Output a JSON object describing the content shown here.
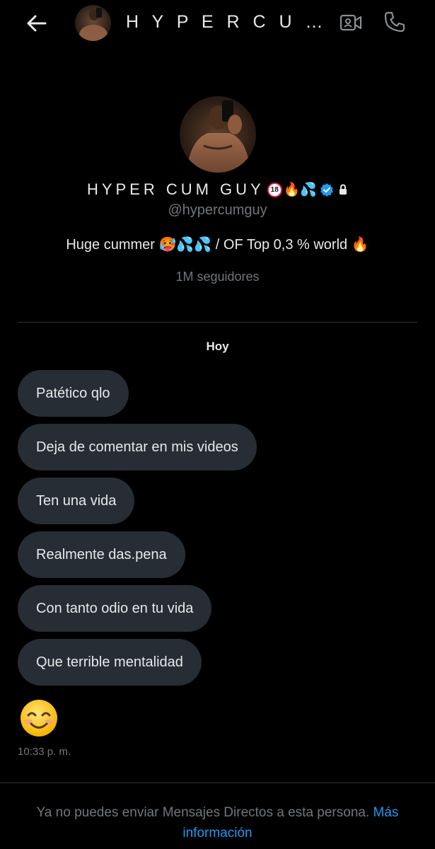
{
  "header": {
    "title": "H Y P E R  C U M  G U Y",
    "back_icon": "arrow-left-icon",
    "video_icon": "video-camera-icon",
    "call_icon": "phone-icon"
  },
  "profile": {
    "name": "HYPER CUM GUY",
    "badge_18": "18",
    "name_emojis": "🔥💦",
    "handle": "@hypercumguy",
    "bio": "Huge cummer 🥵💦💦 / OF Top 0,3 % world 🔥",
    "followers": "1M seguidores",
    "verified_color": "#1d9bf0"
  },
  "conversation": {
    "day_label": "Hoy",
    "messages": [
      "Patético qlo",
      "Deja de comentar en mis videos",
      "Ten una vida",
      "Realmente das.pena",
      "Con tanto odio en tu vida",
      "Que terrible mentalidad"
    ],
    "emoji_message": "smiling-face-emoji",
    "timestamp": "10:33 p. m."
  },
  "footer": {
    "notice": "Ya no puedes enviar Mensajes Directos a esta persona.",
    "link": "Más información"
  },
  "colors": {
    "background": "#000000",
    "bubble": "#262d34",
    "text": "#e7e9ea",
    "muted": "#71767b",
    "accent": "#1d9bf0"
  }
}
